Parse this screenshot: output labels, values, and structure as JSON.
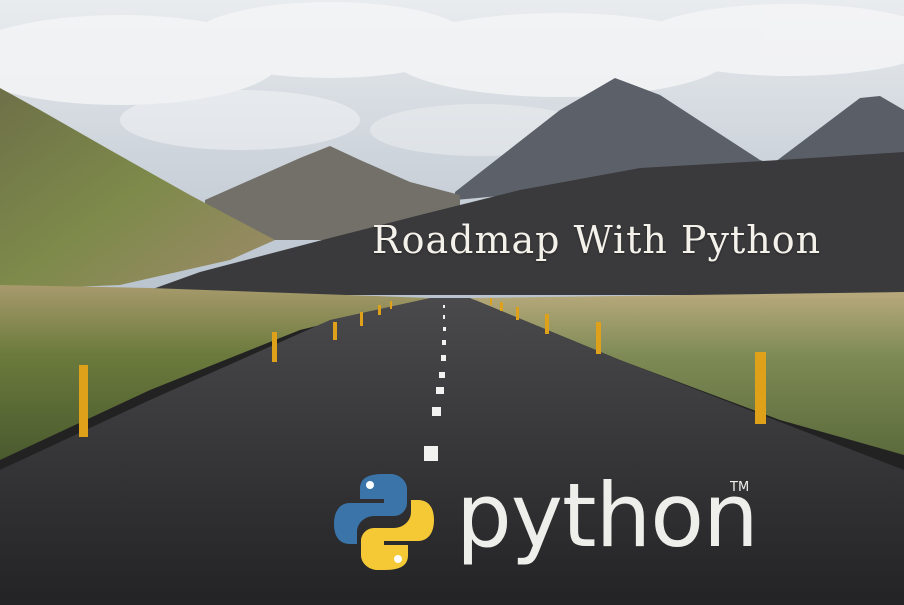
{
  "headline": "Roadmap With Python",
  "logo": {
    "wordmark": "python",
    "trademark": "TM",
    "icon": "python-snake-logo-icon",
    "colors": {
      "blue": "#3a74a8",
      "yellow": "#f5c935"
    }
  },
  "scene": {
    "description_tag": "mountain-road-landscape",
    "colors": {
      "sky": "#c9d1da",
      "road": "#2d2d2f",
      "post": "#e0a11a",
      "hill": "#3b3b3d"
    }
  }
}
